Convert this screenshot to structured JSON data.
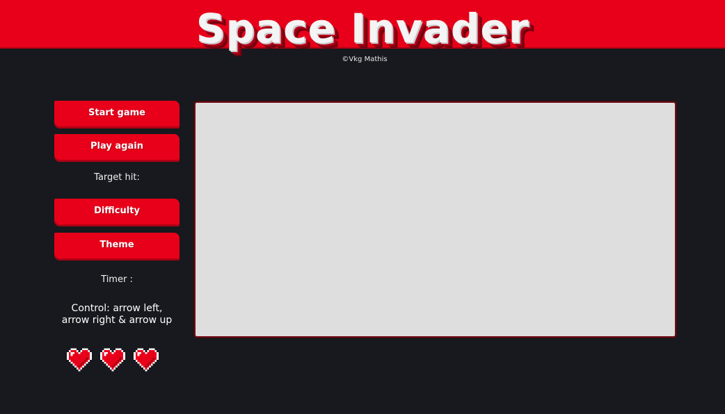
{
  "header": {
    "title": "Space Invader",
    "subtitle": "©Vkg Mathis"
  },
  "sidebar": {
    "start_label": "Start game",
    "play_again_label": "Play again",
    "target_hit_label": "Target hit:",
    "difficulty_label": "Difficulty",
    "theme_label": "Theme",
    "timer_label": "Timer :",
    "control_line1": "Control: arrow left,",
    "control_line2": "arrow right & arrow up"
  },
  "lives": {
    "count": 3,
    "icon": "heart-icon"
  },
  "colors": {
    "accent": "#e8001a",
    "background": "#17191e",
    "game_area": "#dedede"
  }
}
